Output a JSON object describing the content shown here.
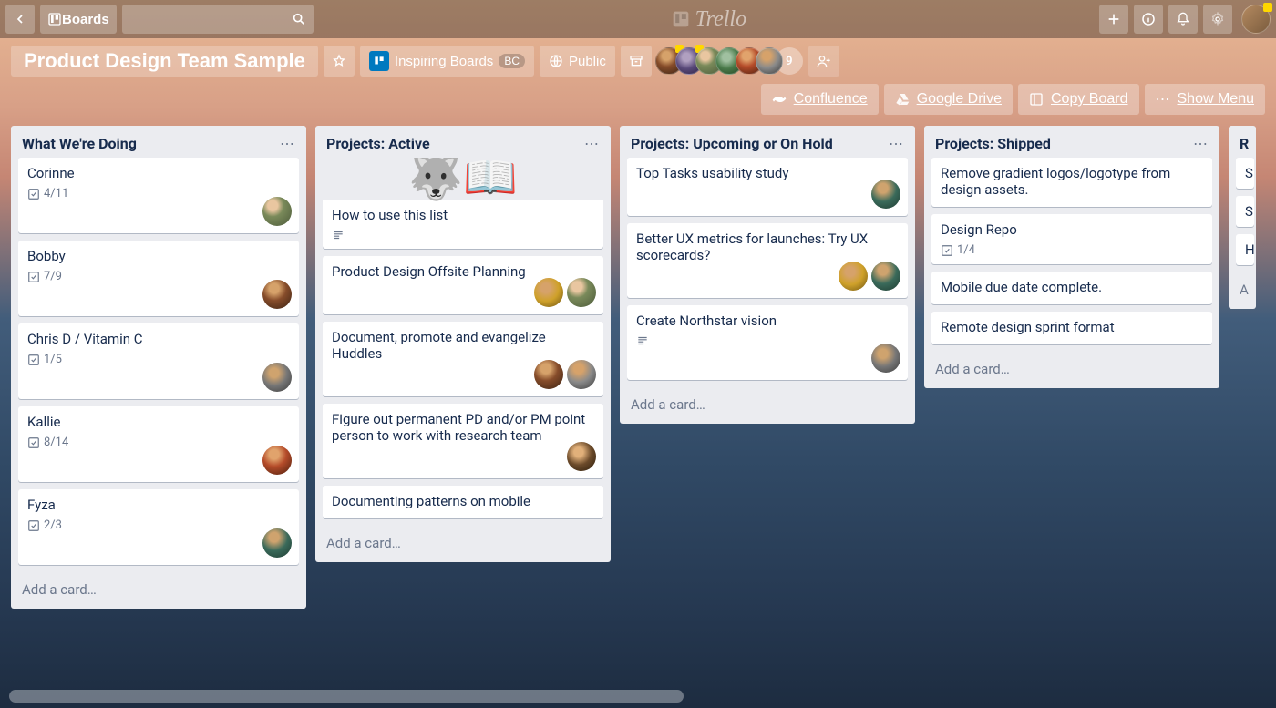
{
  "topnav": {
    "boards_label": "Boards",
    "search_placeholder": ""
  },
  "brand": "Trello",
  "board": {
    "title": "Product Design Team Sample",
    "team_label": "Inspiring Boards",
    "team_badge": "BC",
    "visibility": "Public",
    "member_overflow": "9"
  },
  "actions": {
    "confluence": "Confluence",
    "gdrive": "Google Drive",
    "copy_board": "Copy Board",
    "show_menu": "Show Menu"
  },
  "lists": [
    {
      "title": "What We're Doing",
      "cards": [
        {
          "title": "Corinne",
          "checklist": "4/11",
          "members": [
            "a"
          ]
        },
        {
          "title": "Bobby",
          "checklist": "7/9",
          "members": [
            "b"
          ]
        },
        {
          "title": "Chris D / Vitamin C",
          "checklist": "1/5",
          "members": [
            "c"
          ]
        },
        {
          "title": "Kallie",
          "checklist": "8/14",
          "members": [
            "d"
          ]
        },
        {
          "title": "Fyza",
          "checklist": "2/3",
          "members": [
            "e"
          ]
        }
      ],
      "add": "Add a card…"
    },
    {
      "title": "Projects: Active",
      "cards": [
        {
          "title": "How to use this list",
          "cover": "husky",
          "desc": true
        },
        {
          "title": "Product Design Offsite Planning",
          "members": [
            "f",
            "a"
          ]
        },
        {
          "title": "Document, promote and evangelize Huddles",
          "members": [
            "b",
            "g"
          ]
        },
        {
          "title": "Figure out permanent PD and/or PM point person to work with research team",
          "members": [
            "h"
          ]
        },
        {
          "title": "Documenting patterns on mobile"
        }
      ],
      "add": "Add a card…"
    },
    {
      "title": "Projects: Upcoming or On Hold",
      "cards": [
        {
          "title": "Top Tasks usability study",
          "members": [
            "e"
          ]
        },
        {
          "title": "Better UX metrics for launches: Try UX scorecards?",
          "members": [
            "f",
            "e"
          ]
        },
        {
          "title": "Create Northstar vision",
          "desc": true,
          "members": [
            "c"
          ]
        }
      ],
      "add": "Add a card…"
    },
    {
      "title": "Projects: Shipped",
      "cards": [
        {
          "title": "Remove gradient logos/logotype from design assets."
        },
        {
          "title": "Design Repo",
          "checklist": "1/4"
        },
        {
          "title": "Mobile due date complete."
        },
        {
          "title": "Remote design sprint format"
        }
      ],
      "add": "Add a card…"
    },
    {
      "title_peek": "R",
      "cards_peek": [
        "S",
        "S",
        "H"
      ],
      "add_peek": "A"
    }
  ]
}
